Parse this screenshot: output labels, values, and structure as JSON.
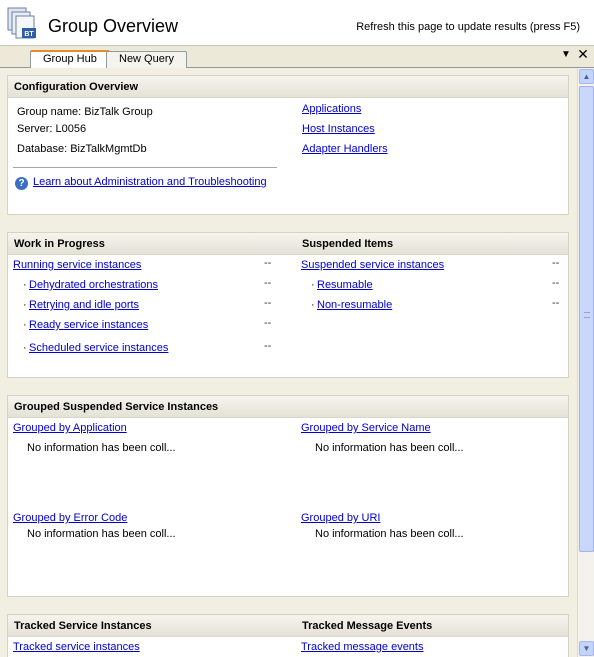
{
  "header": {
    "title": "Group Overview",
    "refresh_hint": "Refresh this page to update results (press F5)",
    "logo_icon": "biztalk-group-icon",
    "logo_badge": "BT"
  },
  "tabs": [
    {
      "label": "Group Hub",
      "active": true
    },
    {
      "label": "New Query",
      "active": false
    }
  ],
  "window_controls": {
    "pin_icon": "dropdown-arrow-icon",
    "pin_glyph": "▼",
    "close_icon": "close-icon",
    "close_glyph": "✕"
  },
  "configuration": {
    "heading": "Configuration Overview",
    "group_name": "Group name: BizTalk Group",
    "server": "Server: L0056",
    "database": "Database: BizTalkMgmtDb",
    "links": [
      "Applications",
      "Host Instances",
      "Adapter Handlers"
    ],
    "help_link": "Learn about Administration and Troubleshooting"
  },
  "work_in_progress": {
    "heading": "Work in Progress",
    "main_link": "Running service instances",
    "main_count": "--",
    "items": [
      {
        "label": "Dehydrated orchestrations",
        "count": "--"
      },
      {
        "label": "Retrying and idle ports",
        "count": "--"
      },
      {
        "label": "Ready service instances",
        "count": "--"
      },
      {
        "label": "Scheduled service instances",
        "count": "--"
      }
    ]
  },
  "suspended_items": {
    "heading": "Suspended Items",
    "main_link": "Suspended service instances",
    "main_count": "--",
    "items": [
      {
        "label": "Resumable",
        "count": "--"
      },
      {
        "label": "Non-resumable",
        "count": "--"
      }
    ]
  },
  "grouped_suspended": {
    "heading": "Grouped Suspended Service Instances",
    "groups": [
      {
        "link": "Grouped by Application",
        "message": "No information has been coll..."
      },
      {
        "link": "Grouped by Service Name",
        "message": "No information has been coll..."
      },
      {
        "link": "Grouped by Error Code",
        "message": "No information has been coll..."
      },
      {
        "link": "Grouped by URI",
        "message": "No information has been coll..."
      }
    ]
  },
  "tracked": {
    "left_heading": "Tracked Service Instances",
    "right_heading": "Tracked Message Events",
    "left_link": "Tracked service instances",
    "right_link": "Tracked message events"
  },
  "bullet": "·",
  "scrollbar": {
    "up_glyph": "▲",
    "down_glyph": "▼"
  }
}
